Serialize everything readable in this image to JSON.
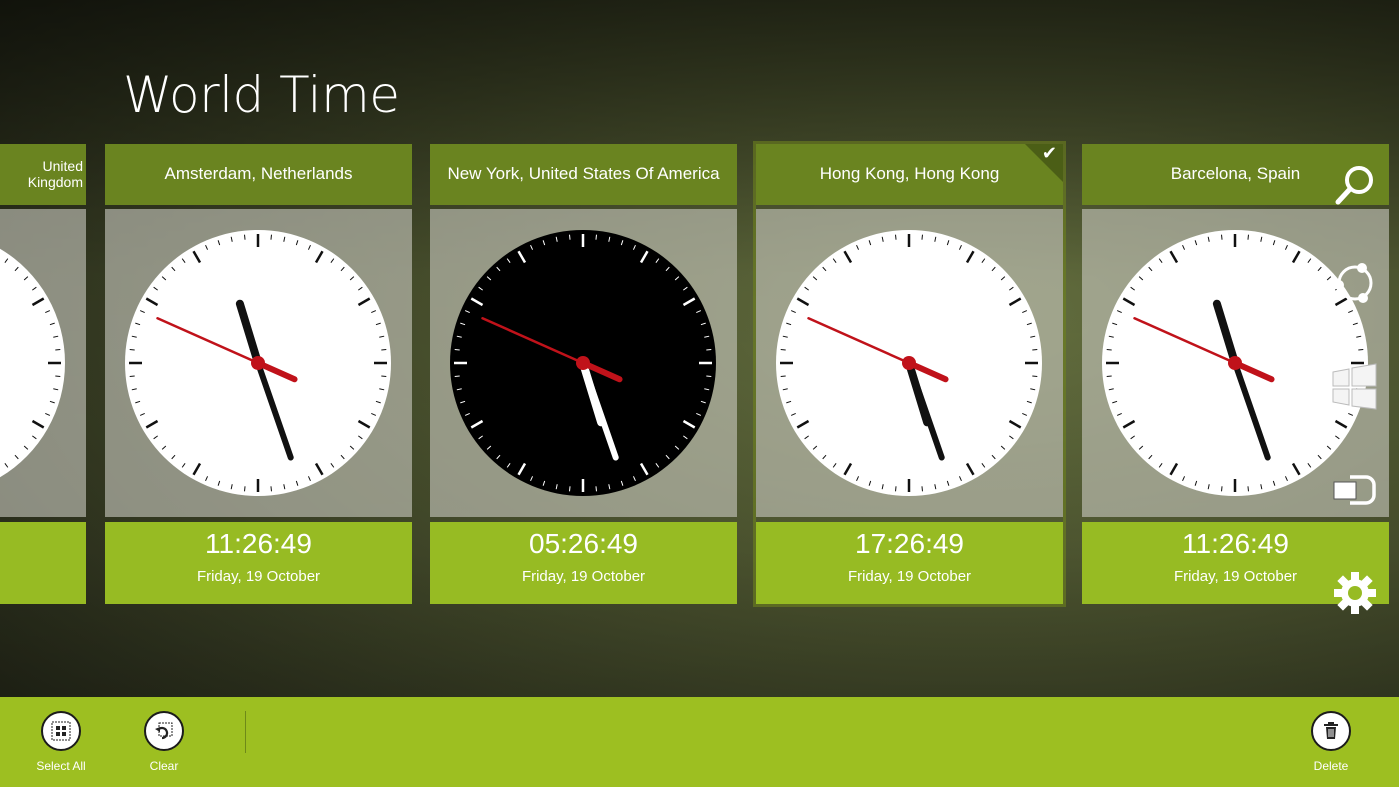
{
  "app": {
    "title": "World Time"
  },
  "tiles": [
    {
      "city": "United Kingdom",
      "time": "",
      "date": "",
      "face": "white",
      "selected": false
    },
    {
      "city": "Amsterdam, Netherlands",
      "time": "11:26:49",
      "date": "Friday, 19 October",
      "face": "white",
      "selected": false
    },
    {
      "city": "New York, United States Of America",
      "time": "05:26:49",
      "date": "Friday, 19 October",
      "face": "black",
      "selected": false
    },
    {
      "city": "Hong Kong, Hong Kong",
      "time": "17:26:49",
      "date": "Friday, 19 October",
      "face": "white",
      "selected": true
    },
    {
      "city": "Barcelona, Spain",
      "time": "11:26:49",
      "date": "Friday, 19 October",
      "face": "white",
      "selected": false
    }
  ],
  "charms": [
    "search-icon",
    "share-icon",
    "start-icon",
    "devices-icon",
    "settings-icon"
  ],
  "appbar": {
    "select_all": "Select All",
    "clear": "Clear",
    "delete": "Delete"
  },
  "colors": {
    "header": "#6a8420",
    "footer": "#97bb23",
    "appbar": "#9dbf21",
    "second_hand": "#c0121a"
  }
}
